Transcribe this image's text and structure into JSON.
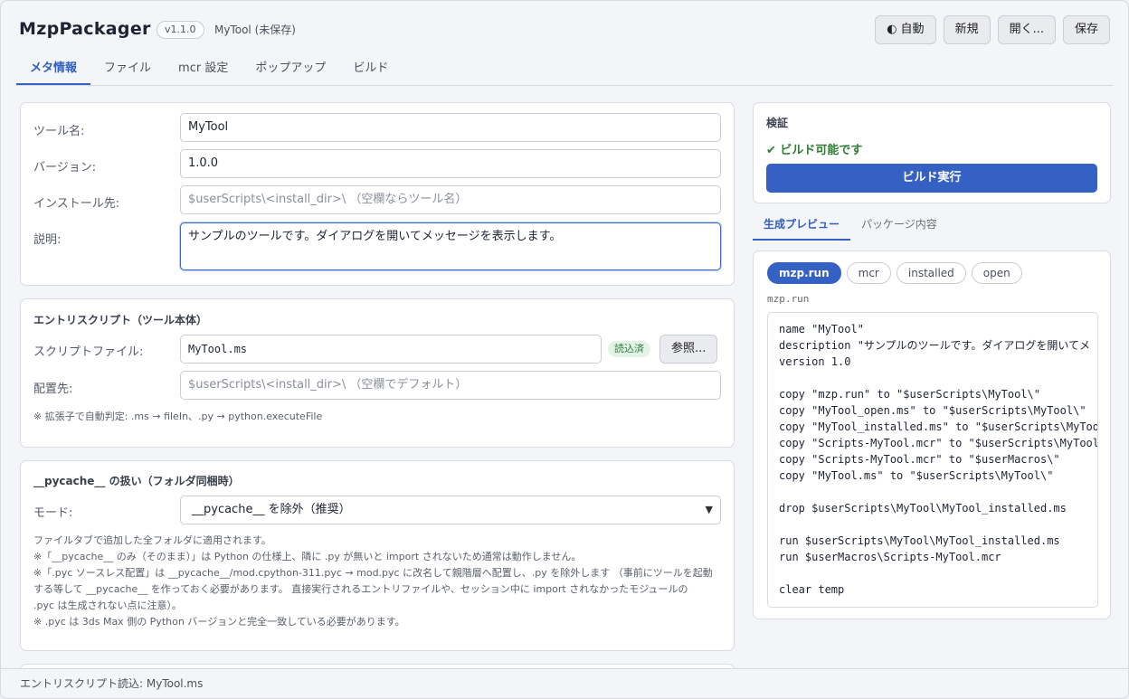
{
  "header": {
    "app_title": "MzpPackager",
    "version": "v1.1.0",
    "doc_name": "MyTool (未保存)",
    "theme_label": "自動",
    "theme_icon": "◐",
    "new_label": "新規",
    "open_label": "開く...",
    "save_label": "保存"
  },
  "tabs": [
    "メタ情報",
    "ファイル",
    "mcr 設定",
    "ポップアップ",
    "ビルド"
  ],
  "meta": {
    "tool_name_label": "ツール名:",
    "tool_name_value": "MyTool",
    "version_label": "バージョン:",
    "version_value": "1.0.0",
    "install_label": "インストール先:",
    "install_placeholder": "$userScripts\\<install_dir>\\ （空欄ならツール名）",
    "desc_label": "説明:",
    "desc_value": "サンプルのツールです。ダイアログを開いてメッセージを表示します。"
  },
  "entry": {
    "title": "エントリスクリプト（ツール本体）",
    "file_label": "スクリプトファイル:",
    "file_value": "MyTool.ms",
    "loaded_badge": "読込済",
    "browse_label": "参照...",
    "dest_label": "配置先:",
    "dest_placeholder": "$userScripts\\<install_dir>\\ （空欄でデフォルト）",
    "note": "※ 拡張子で自動判定: .ms → fileIn、.py → python.executeFile"
  },
  "pycache": {
    "title": "__pycache__ の扱い（フォルダ同梱時）",
    "mode_label": "モード:",
    "mode_value": "__pycache__ を除外（推奨）",
    "notes": [
      "ファイルタブで追加した全フォルダに適用されます。",
      "※「__pycache__ のみ（そのまま）」は Python の仕様上、隣に .py が無いと import されないため通常は動作しません。",
      "※「.pyc ソースレス配置」は __pycache__/mod.cpython-311.pyc → mod.pyc に改名して親階層へ配置し、.py を除外します （事前にツールを起動",
      "する等して __pycache__ を作っておく必要があります。 直接実行されるエントリファイルや、セッション中に import されなかったモジュールの",
      ".pyc は生成されない点に注意）。",
      "※ .pyc は 3ds Max 側の Python バージョンと完全一致している必要があります。"
    ]
  },
  "validation": {
    "title": "検証",
    "status": "✔ ビルド可能です",
    "build_button": "ビルド実行"
  },
  "preview": {
    "tabs": [
      "生成プレビュー",
      "パッケージ内容"
    ],
    "pills": [
      "mzp.run",
      "mcr",
      "installed",
      "open"
    ],
    "file_name": "mzp.run",
    "code": [
      "name \"MyTool\"",
      "description \"サンプルのツールです。ダイアログを開いてメ",
      "version 1.0",
      "",
      "copy \"mzp.run\" to \"$userScripts\\MyTool\\\"",
      "copy \"MyTool_open.ms\" to \"$userScripts\\MyTool\\\"",
      "copy \"MyTool_installed.ms\" to \"$userScripts\\MyToo",
      "copy \"Scripts-MyTool.mcr\" to \"$userScripts\\MyTool",
      "copy \"Scripts-MyTool.mcr\" to \"$userMacros\\\"",
      "copy \"MyTool.ms\" to \"$userScripts\\MyTool\\\"",
      "",
      "drop $userScripts\\MyTool\\MyTool_installed.ms",
      "",
      "run $userScripts\\MyTool\\MyTool_installed.ms",
      "run $userMacros\\Scripts-MyTool.mcr",
      "",
      "clear temp"
    ]
  },
  "status": {
    "text": "エントリスクリプト読込: MyTool.ms"
  }
}
